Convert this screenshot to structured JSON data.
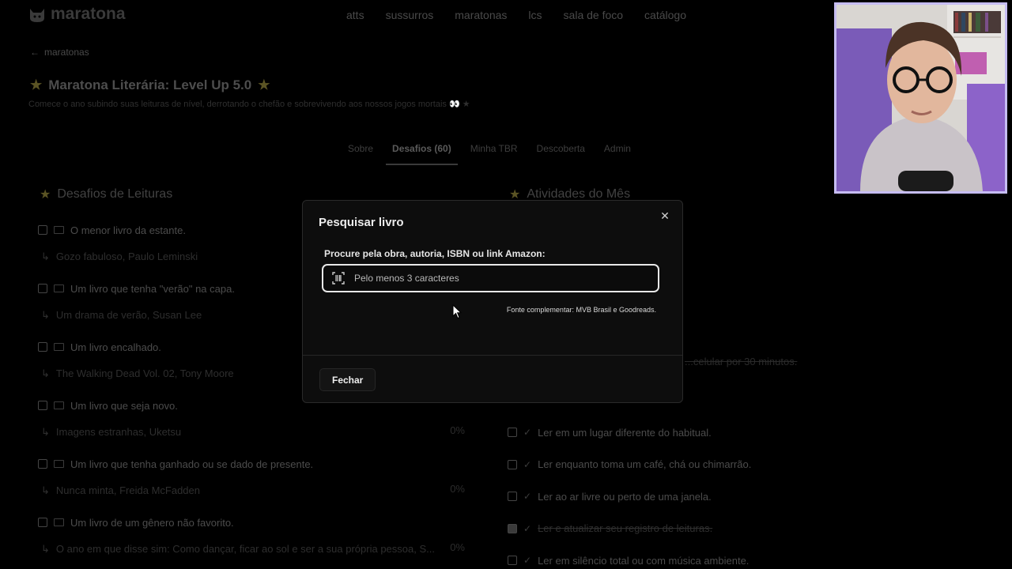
{
  "brand": "maratona",
  "nav": [
    "atts",
    "sussurros",
    "maratonas",
    "lcs",
    "sala de foco",
    "catálogo"
  ],
  "breadcrumb": "maratonas",
  "page_title": "Maratona Literária: Level Up 5.0",
  "page_subtitle": "Comece o ano subindo suas leituras de nível, derrotando o chefão e sobrevivendo aos nossos jogos mortais 👀 ★",
  "tabs": [
    "Sobre",
    "Desafios (60)",
    "Minha TBR",
    "Descoberta",
    "Admin"
  ],
  "left_section": "Desafios de Leituras",
  "right_section": "Atividades do Mês",
  "challenges": [
    {
      "label": "O menor livro da estante.",
      "book": "Gozo fabuloso, Paulo Leminski",
      "pct": ""
    },
    {
      "label": "Um livro que tenha \"verão\" na capa.",
      "book": "Um drama de verão, Susan Lee",
      "pct": ""
    },
    {
      "label": "Um livro encalhado.",
      "book": "The Walking Dead Vol. 02, Tony Moore",
      "pct": ""
    },
    {
      "label": "Um livro que seja novo.",
      "book": "Imagens estranhas, Uketsu",
      "pct": "0%"
    },
    {
      "label": "Um livro que tenha ganhado ou se dado de presente.",
      "book": "Nunca minta, Freida McFadden",
      "pct": "0%"
    },
    {
      "label": "Um livro de um gênero não favorito.",
      "book": "O ano em que disse sim: Como dançar, ficar ao sol e ser a sua própria pessoa, S...",
      "pct": "0%"
    }
  ],
  "activities": [
    {
      "label": "Ler em um lugar diferente do habitual.",
      "done": false
    },
    {
      "label": "Ler enquanto toma um café, chá ou chimarrão.",
      "done": false
    },
    {
      "label": "Ler ao ar livre ou perto de uma janela.",
      "done": false
    },
    {
      "label": "Ler e atualizar seu registro de leituras.",
      "done": true
    },
    {
      "label": "Ler em silêncio total ou com música ambiente.",
      "done": false
    }
  ],
  "ghost_activity": "...celular por 30 minutos.",
  "modal": {
    "title": "Pesquisar livro",
    "search_label": "Procure pela obra, autoria, ISBN ou link Amazon:",
    "search_placeholder": "Pelo menos 3 caracteres",
    "search_value": "",
    "source_note": "Fonte complementar: MVB Brasil e Goodreads.",
    "close_button": "Fechar"
  },
  "colors": {
    "modal_bg": "#0d0d0d",
    "accent_star": "#5b5424",
    "webcam_border": "#c6bdf2"
  }
}
